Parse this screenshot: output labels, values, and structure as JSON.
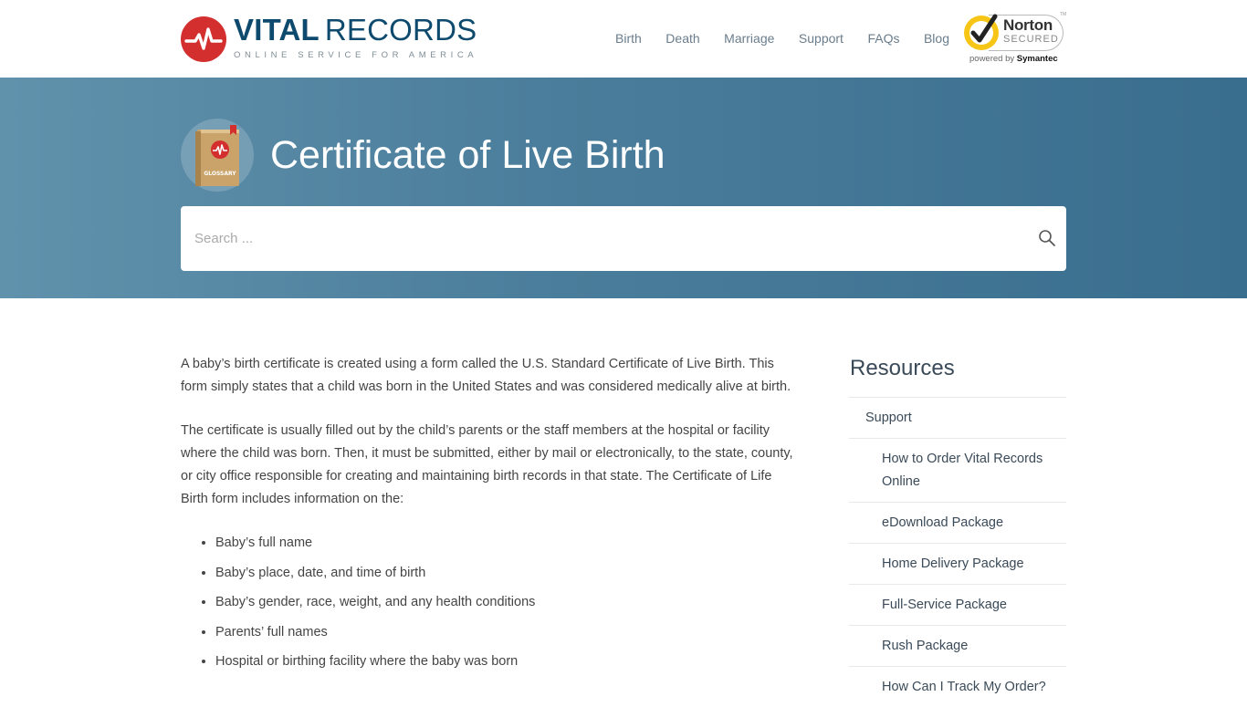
{
  "brand": {
    "name_bold": "VITAL",
    "name_regular": "RECORDS",
    "tagline": "ONLINE SERVICE FOR AMERICA",
    "primary_color": "#0e4a6e",
    "accent_color": "#d32f2f"
  },
  "nav": {
    "items": [
      {
        "label": "Birth"
      },
      {
        "label": "Death"
      },
      {
        "label": "Marriage"
      },
      {
        "label": "Support"
      },
      {
        "label": "FAQs"
      },
      {
        "label": "Blog"
      }
    ]
  },
  "norton": {
    "name": "Norton",
    "secured": "SECURED",
    "tm": "TM",
    "powered_by": "powered by",
    "company": "Symantec"
  },
  "hero": {
    "icon_label": "GLOSSARY",
    "title": "Certificate of Live Birth",
    "search_placeholder": "Search ..."
  },
  "article": {
    "paragraphs": [
      "A baby’s birth certificate is created using a form called the U.S. Standard Certificate of Live Birth. This form simply states that a child was born in the United States and was considered medically alive at birth.",
      "The certificate is usually filled out by the child’s parents or the staff members at the hospital or facility where the child was born. Then, it must be submitted, either by mail or electronically, to the state, county, or city office responsible for creating and maintaining birth records in that state. The Certificate of Life Birth form includes information on the:"
    ],
    "list": [
      "Baby’s full name",
      "Baby’s place, date, and time of birth",
      "Baby’s gender, race, weight, and any health conditions",
      "Parents’ full names",
      "Hospital or birthing facility where the baby was born"
    ]
  },
  "sidebar": {
    "title": "Resources",
    "items": [
      {
        "label": "Support"
      },
      {
        "label": "How to Order Vital Records Online"
      },
      {
        "label": "eDownload Package"
      },
      {
        "label": "Home Delivery Package"
      },
      {
        "label": "Full-Service Package"
      },
      {
        "label": "Rush Package"
      },
      {
        "label": "How Can I Track My Order?"
      }
    ]
  }
}
